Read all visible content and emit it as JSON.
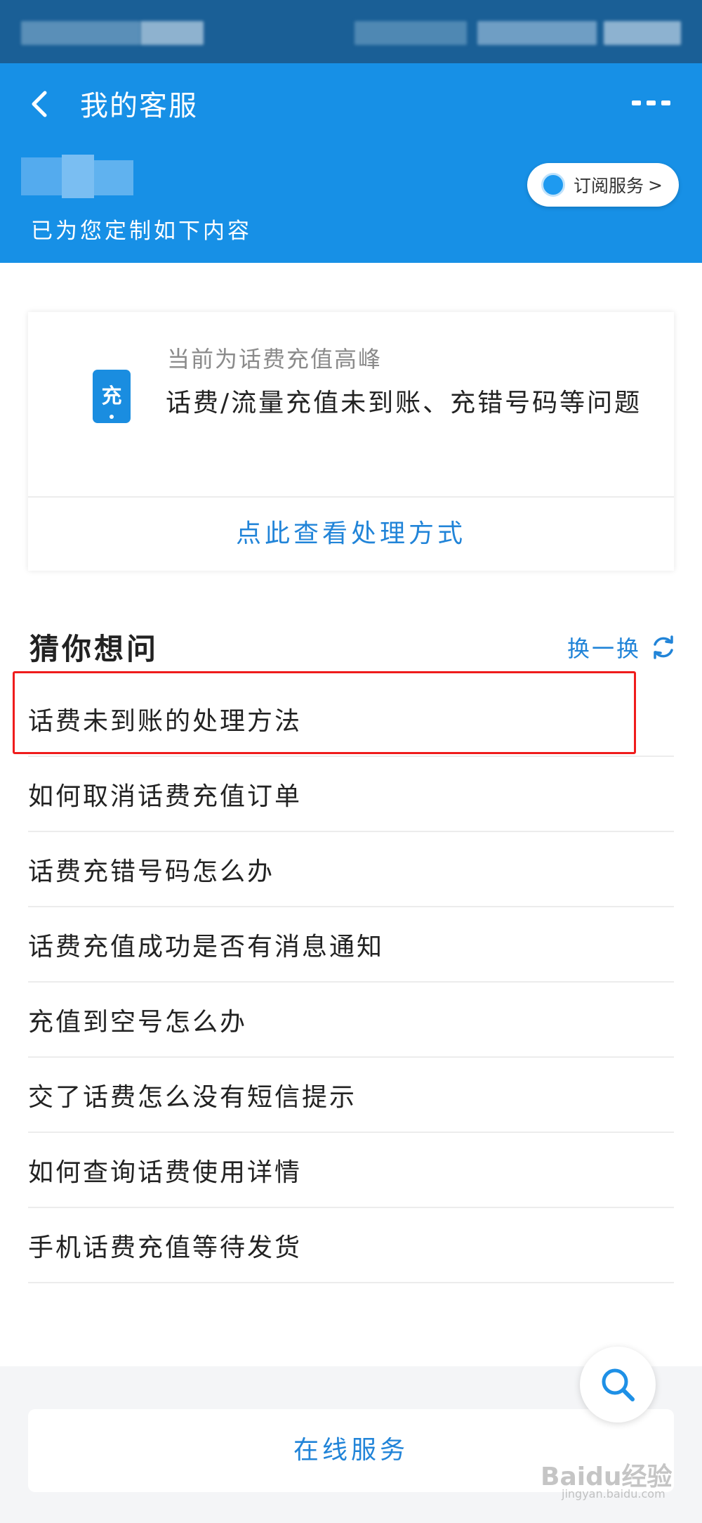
{
  "header": {
    "title": "我的客服",
    "custom_text": "已为您定制如下内容",
    "subscribe_label": "订阅服务",
    "subscribe_arrow": ">"
  },
  "notice": {
    "peak_text": "当前为话费充值高峰",
    "issue_text": "话费/流量充值未到账、充错号码等问题",
    "icon_char": "充",
    "link_text": "点此查看处理方式"
  },
  "guess": {
    "title": "猜你想问",
    "refresh_label": "换一换",
    "questions": [
      "话费未到账的处理方法",
      "如何取消话费充值订单",
      "话费充错号码怎么办",
      "话费充值成功是否有消息通知",
      "充值到空号怎么办",
      "交了话费怎么没有短信提示",
      "如何查询话费使用详情",
      "手机话费充值等待发货"
    ]
  },
  "bottom": {
    "online_service": "在线服务"
  },
  "watermark": {
    "text": "Baidu经验",
    "sub": "jingyan.baidu.com"
  },
  "colors": {
    "header_bg": "#1790e6",
    "accent": "#2184d8",
    "highlight": "#ef1c1c"
  }
}
